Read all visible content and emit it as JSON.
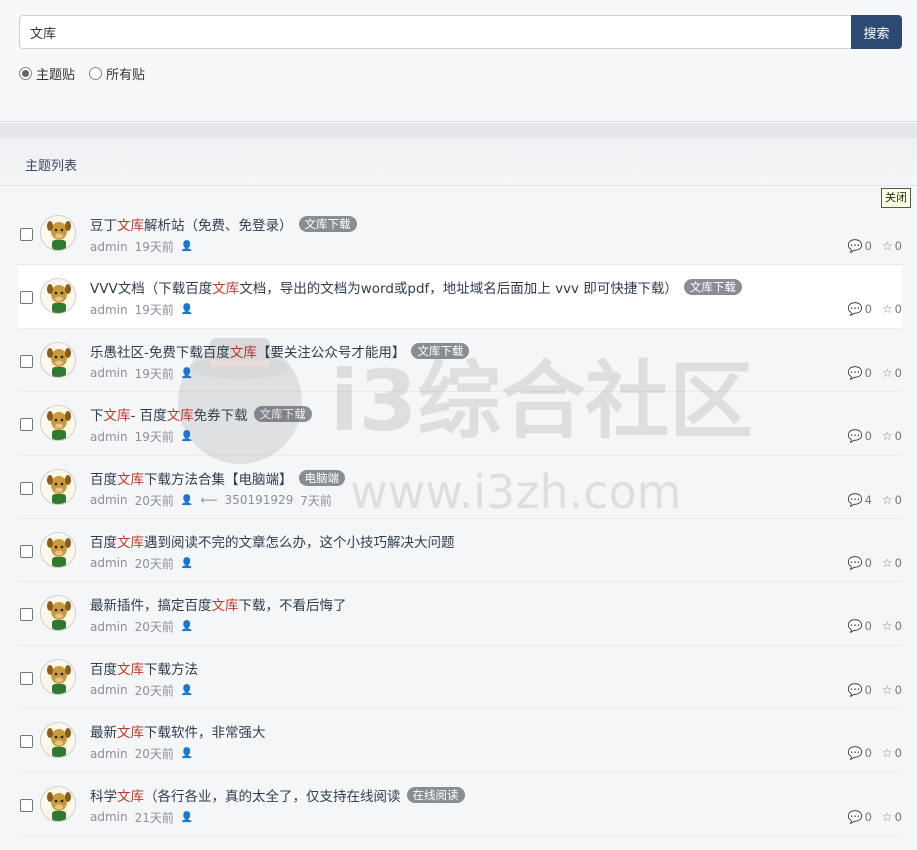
{
  "search": {
    "value": "文库",
    "button_label": "搜索",
    "radio_options": [
      {
        "label": "主题贴",
        "checked": true
      },
      {
        "label": "所有贴",
        "checked": false
      }
    ]
  },
  "list": {
    "header": "主题列表",
    "close_label": "关闭",
    "watermark": {
      "line1": "i3综合社区",
      "line2": "www.i3zh.com"
    },
    "threads": [
      {
        "title_parts": [
          "豆丁",
          "文库",
          "解析站（免费、免登录）"
        ],
        "tag": "文库下载",
        "author": "admin",
        "time": "19天前",
        "last_reply_user": "",
        "last_reply_time": "",
        "comments": "0",
        "stars": "0",
        "highlight": false
      },
      {
        "title_parts": [
          "VVV文档（下载百度",
          "文库",
          "文档，导出的文档为word或pdf，地址域名后面加上 vvv 即可快捷下载）"
        ],
        "tag": "文库下载",
        "author": "admin",
        "time": "19天前",
        "last_reply_user": "",
        "last_reply_time": "",
        "comments": "0",
        "stars": "0",
        "highlight": true
      },
      {
        "title_parts": [
          "乐愚社区-免费下载百度",
          "文库",
          "【要关注公众号才能用】"
        ],
        "tag": "文库下载",
        "author": "admin",
        "time": "19天前",
        "last_reply_user": "",
        "last_reply_time": "",
        "comments": "0",
        "stars": "0",
        "highlight": false
      },
      {
        "title_parts": [
          "下",
          "文库",
          " - 百度",
          "文库",
          "免券下载"
        ],
        "tag": "文库下载",
        "author": "admin",
        "time": "19天前",
        "last_reply_user": "",
        "last_reply_time": "",
        "comments": "0",
        "stars": "0",
        "highlight": false
      },
      {
        "title_parts": [
          "百度",
          "文库",
          "下载方法合集【电脑端】"
        ],
        "tag": "电脑端",
        "author": "admin",
        "time": "20天前",
        "last_reply_user": "350191929",
        "last_reply_time": "7天前",
        "comments": "4",
        "stars": "0",
        "highlight": false
      },
      {
        "title_parts": [
          "百度",
          "文库",
          "遇到阅读不完的文章怎么办，这个小技巧解决大问题"
        ],
        "tag": "",
        "author": "admin",
        "time": "20天前",
        "last_reply_user": "",
        "last_reply_time": "",
        "comments": "0",
        "stars": "0",
        "highlight": false
      },
      {
        "title_parts": [
          "最新插件，搞定百度",
          "文库",
          "下载，不看后悔了"
        ],
        "tag": "",
        "author": "admin",
        "time": "20天前",
        "last_reply_user": "",
        "last_reply_time": "",
        "comments": "0",
        "stars": "0",
        "highlight": false
      },
      {
        "title_parts": [
          "百度",
          "文库",
          "下载方法"
        ],
        "tag": "",
        "author": "admin",
        "time": "20天前",
        "last_reply_user": "",
        "last_reply_time": "",
        "comments": "0",
        "stars": "0",
        "highlight": false
      },
      {
        "title_parts": [
          "最新",
          "文库",
          "下载软件，非常强大"
        ],
        "tag": "",
        "author": "admin",
        "time": "20天前",
        "last_reply_user": "",
        "last_reply_time": "",
        "comments": "0",
        "stars": "0",
        "highlight": false
      },
      {
        "title_parts": [
          "科学",
          "文库",
          "（各行各业，真的太全了，仅支持在线阅读"
        ],
        "tag": "在线阅读",
        "author": "admin",
        "time": "21天前",
        "last_reply_user": "",
        "last_reply_time": "",
        "comments": "0",
        "stars": "0",
        "highlight": false
      }
    ]
  }
}
